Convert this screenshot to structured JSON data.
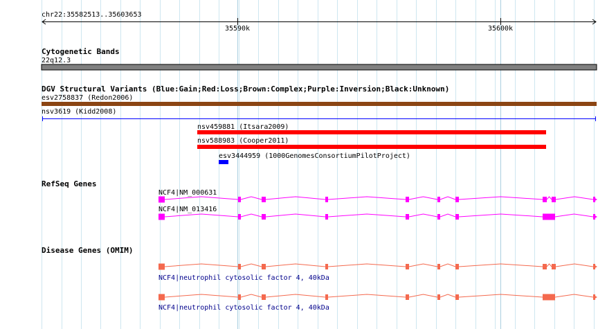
{
  "location": "chr22:35582513..35603653",
  "ruler": {
    "ticks": [
      "35590k",
      "35600k"
    ]
  },
  "tracks": {
    "cytoband": {
      "title": "Cytogenetic Bands",
      "band": "22q12.3"
    },
    "dgv": {
      "title": "DGV Structural Variants (Blue:Gain;Red:Loss;Brown:Complex;Purple:Inversion;Black:Unknown)",
      "features": [
        {
          "label": "esv2758837 (Redon2006)",
          "color": "#8b4513"
        },
        {
          "label": "nsv3619 (Kidd2008)",
          "color": "#0000ff"
        },
        {
          "label": "nsv459881 (Itsara2009)",
          "color": "#ff0000"
        },
        {
          "label": "nsv588983 (Cooper2011)",
          "color": "#ff0000"
        },
        {
          "label": "esv3444959 (1000GenomesConsortiumPilotProject)",
          "color": "#0000ff"
        }
      ]
    },
    "refseq": {
      "title": "RefSeq Genes",
      "color": "#ff00ff",
      "transcripts": [
        {
          "label": "NCF4|NM_000631"
        },
        {
          "label": "NCF4|NM_013416"
        }
      ]
    },
    "omim": {
      "title": "Disease Genes (OMIM)",
      "color": "#f4694e",
      "entries": [
        {
          "label": "NCF4|neutrophil cytosolic factor 4, 40kDa"
        },
        {
          "label": "NCF4|neutrophil cytosolic factor 4, 40kDa"
        }
      ]
    }
  }
}
